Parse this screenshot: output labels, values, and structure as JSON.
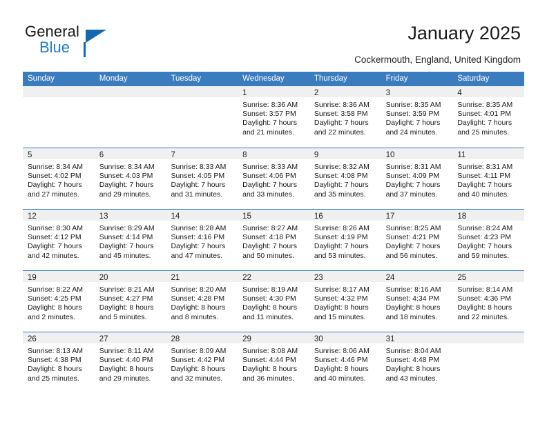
{
  "brand": {
    "word_one": "General",
    "word_two": "Blue",
    "accent_color": "#1368b0",
    "blue_text_color": "#1f7cc4"
  },
  "header": {
    "title": "January 2025",
    "location": "Cockermouth, England, United Kingdom"
  },
  "theme": {
    "header_blue": "#3b7cbf",
    "daynum_band": "#f0f0f0",
    "cell_background": "#ffffff",
    "text_color": "#1a1a1a"
  },
  "calendar": {
    "weekday_headers": [
      "Sunday",
      "Monday",
      "Tuesday",
      "Wednesday",
      "Thursday",
      "Friday",
      "Saturday"
    ],
    "weeks": [
      [
        {
          "empty": true,
          "day": "",
          "sunrise": "",
          "sunset": "",
          "daylight_line1": "",
          "daylight_line2": ""
        },
        {
          "empty": true,
          "day": "",
          "sunrise": "",
          "sunset": "",
          "daylight_line1": "",
          "daylight_line2": ""
        },
        {
          "empty": true,
          "day": "",
          "sunrise": "",
          "sunset": "",
          "daylight_line1": "",
          "daylight_line2": ""
        },
        {
          "empty": false,
          "day": "1",
          "sunrise": "Sunrise: 8:36 AM",
          "sunset": "Sunset: 3:57 PM",
          "daylight_line1": "Daylight: 7 hours",
          "daylight_line2": "and 21 minutes."
        },
        {
          "empty": false,
          "day": "2",
          "sunrise": "Sunrise: 8:36 AM",
          "sunset": "Sunset: 3:58 PM",
          "daylight_line1": "Daylight: 7 hours",
          "daylight_line2": "and 22 minutes."
        },
        {
          "empty": false,
          "day": "3",
          "sunrise": "Sunrise: 8:35 AM",
          "sunset": "Sunset: 3:59 PM",
          "daylight_line1": "Daylight: 7 hours",
          "daylight_line2": "and 24 minutes."
        },
        {
          "empty": false,
          "day": "4",
          "sunrise": "Sunrise: 8:35 AM",
          "sunset": "Sunset: 4:01 PM",
          "daylight_line1": "Daylight: 7 hours",
          "daylight_line2": "and 25 minutes."
        }
      ],
      [
        {
          "empty": false,
          "day": "5",
          "sunrise": "Sunrise: 8:34 AM",
          "sunset": "Sunset: 4:02 PM",
          "daylight_line1": "Daylight: 7 hours",
          "daylight_line2": "and 27 minutes."
        },
        {
          "empty": false,
          "day": "6",
          "sunrise": "Sunrise: 8:34 AM",
          "sunset": "Sunset: 4:03 PM",
          "daylight_line1": "Daylight: 7 hours",
          "daylight_line2": "and 29 minutes."
        },
        {
          "empty": false,
          "day": "7",
          "sunrise": "Sunrise: 8:33 AM",
          "sunset": "Sunset: 4:05 PM",
          "daylight_line1": "Daylight: 7 hours",
          "daylight_line2": "and 31 minutes."
        },
        {
          "empty": false,
          "day": "8",
          "sunrise": "Sunrise: 8:33 AM",
          "sunset": "Sunset: 4:06 PM",
          "daylight_line1": "Daylight: 7 hours",
          "daylight_line2": "and 33 minutes."
        },
        {
          "empty": false,
          "day": "9",
          "sunrise": "Sunrise: 8:32 AM",
          "sunset": "Sunset: 4:08 PM",
          "daylight_line1": "Daylight: 7 hours",
          "daylight_line2": "and 35 minutes."
        },
        {
          "empty": false,
          "day": "10",
          "sunrise": "Sunrise: 8:31 AM",
          "sunset": "Sunset: 4:09 PM",
          "daylight_line1": "Daylight: 7 hours",
          "daylight_line2": "and 37 minutes."
        },
        {
          "empty": false,
          "day": "11",
          "sunrise": "Sunrise: 8:31 AM",
          "sunset": "Sunset: 4:11 PM",
          "daylight_line1": "Daylight: 7 hours",
          "daylight_line2": "and 40 minutes."
        }
      ],
      [
        {
          "empty": false,
          "day": "12",
          "sunrise": "Sunrise: 8:30 AM",
          "sunset": "Sunset: 4:12 PM",
          "daylight_line1": "Daylight: 7 hours",
          "daylight_line2": "and 42 minutes."
        },
        {
          "empty": false,
          "day": "13",
          "sunrise": "Sunrise: 8:29 AM",
          "sunset": "Sunset: 4:14 PM",
          "daylight_line1": "Daylight: 7 hours",
          "daylight_line2": "and 45 minutes."
        },
        {
          "empty": false,
          "day": "14",
          "sunrise": "Sunrise: 8:28 AM",
          "sunset": "Sunset: 4:16 PM",
          "daylight_line1": "Daylight: 7 hours",
          "daylight_line2": "and 47 minutes."
        },
        {
          "empty": false,
          "day": "15",
          "sunrise": "Sunrise: 8:27 AM",
          "sunset": "Sunset: 4:18 PM",
          "daylight_line1": "Daylight: 7 hours",
          "daylight_line2": "and 50 minutes."
        },
        {
          "empty": false,
          "day": "16",
          "sunrise": "Sunrise: 8:26 AM",
          "sunset": "Sunset: 4:19 PM",
          "daylight_line1": "Daylight: 7 hours",
          "daylight_line2": "and 53 minutes."
        },
        {
          "empty": false,
          "day": "17",
          "sunrise": "Sunrise: 8:25 AM",
          "sunset": "Sunset: 4:21 PM",
          "daylight_line1": "Daylight: 7 hours",
          "daylight_line2": "and 56 minutes."
        },
        {
          "empty": false,
          "day": "18",
          "sunrise": "Sunrise: 8:24 AM",
          "sunset": "Sunset: 4:23 PM",
          "daylight_line1": "Daylight: 7 hours",
          "daylight_line2": "and 59 minutes."
        }
      ],
      [
        {
          "empty": false,
          "day": "19",
          "sunrise": "Sunrise: 8:22 AM",
          "sunset": "Sunset: 4:25 PM",
          "daylight_line1": "Daylight: 8 hours",
          "daylight_line2": "and 2 minutes."
        },
        {
          "empty": false,
          "day": "20",
          "sunrise": "Sunrise: 8:21 AM",
          "sunset": "Sunset: 4:27 PM",
          "daylight_line1": "Daylight: 8 hours",
          "daylight_line2": "and 5 minutes."
        },
        {
          "empty": false,
          "day": "21",
          "sunrise": "Sunrise: 8:20 AM",
          "sunset": "Sunset: 4:28 PM",
          "daylight_line1": "Daylight: 8 hours",
          "daylight_line2": "and 8 minutes."
        },
        {
          "empty": false,
          "day": "22",
          "sunrise": "Sunrise: 8:19 AM",
          "sunset": "Sunset: 4:30 PM",
          "daylight_line1": "Daylight: 8 hours",
          "daylight_line2": "and 11 minutes."
        },
        {
          "empty": false,
          "day": "23",
          "sunrise": "Sunrise: 8:17 AM",
          "sunset": "Sunset: 4:32 PM",
          "daylight_line1": "Daylight: 8 hours",
          "daylight_line2": "and 15 minutes."
        },
        {
          "empty": false,
          "day": "24",
          "sunrise": "Sunrise: 8:16 AM",
          "sunset": "Sunset: 4:34 PM",
          "daylight_line1": "Daylight: 8 hours",
          "daylight_line2": "and 18 minutes."
        },
        {
          "empty": false,
          "day": "25",
          "sunrise": "Sunrise: 8:14 AM",
          "sunset": "Sunset: 4:36 PM",
          "daylight_line1": "Daylight: 8 hours",
          "daylight_line2": "and 22 minutes."
        }
      ],
      [
        {
          "empty": false,
          "day": "26",
          "sunrise": "Sunrise: 8:13 AM",
          "sunset": "Sunset: 4:38 PM",
          "daylight_line1": "Daylight: 8 hours",
          "daylight_line2": "and 25 minutes."
        },
        {
          "empty": false,
          "day": "27",
          "sunrise": "Sunrise: 8:11 AM",
          "sunset": "Sunset: 4:40 PM",
          "daylight_line1": "Daylight: 8 hours",
          "daylight_line2": "and 29 minutes."
        },
        {
          "empty": false,
          "day": "28",
          "sunrise": "Sunrise: 8:09 AM",
          "sunset": "Sunset: 4:42 PM",
          "daylight_line1": "Daylight: 8 hours",
          "daylight_line2": "and 32 minutes."
        },
        {
          "empty": false,
          "day": "29",
          "sunrise": "Sunrise: 8:08 AM",
          "sunset": "Sunset: 4:44 PM",
          "daylight_line1": "Daylight: 8 hours",
          "daylight_line2": "and 36 minutes."
        },
        {
          "empty": false,
          "day": "30",
          "sunrise": "Sunrise: 8:06 AM",
          "sunset": "Sunset: 4:46 PM",
          "daylight_line1": "Daylight: 8 hours",
          "daylight_line2": "and 40 minutes."
        },
        {
          "empty": false,
          "day": "31",
          "sunrise": "Sunrise: 8:04 AM",
          "sunset": "Sunset: 4:48 PM",
          "daylight_line1": "Daylight: 8 hours",
          "daylight_line2": "and 43 minutes."
        },
        {
          "empty": true,
          "day": "",
          "sunrise": "",
          "sunset": "",
          "daylight_line1": "",
          "daylight_line2": ""
        }
      ]
    ]
  }
}
